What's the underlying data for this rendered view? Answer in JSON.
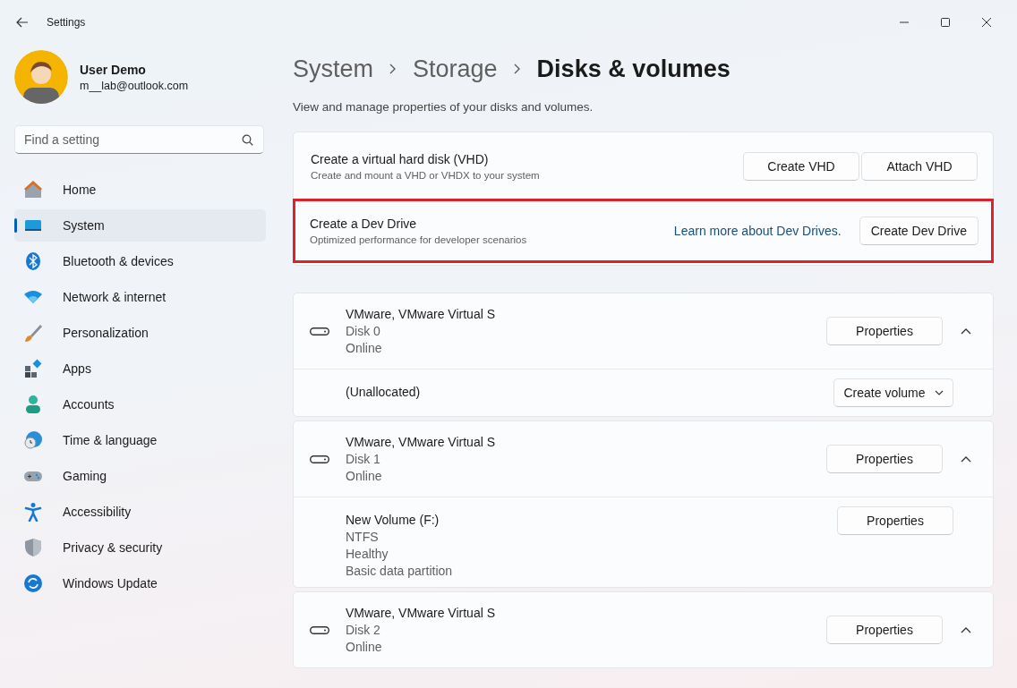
{
  "window": {
    "title": "Settings"
  },
  "user": {
    "name": "User Demo",
    "email": "m__lab@outlook.com"
  },
  "search": {
    "placeholder": "Find a setting"
  },
  "sidebar": {
    "items": [
      {
        "label": "Home",
        "selected": false
      },
      {
        "label": "System",
        "selected": true
      },
      {
        "label": "Bluetooth & devices",
        "selected": false
      },
      {
        "label": "Network & internet",
        "selected": false
      },
      {
        "label": "Personalization",
        "selected": false
      },
      {
        "label": "Apps",
        "selected": false
      },
      {
        "label": "Accounts",
        "selected": false
      },
      {
        "label": "Time & language",
        "selected": false
      },
      {
        "label": "Gaming",
        "selected": false
      },
      {
        "label": "Accessibility",
        "selected": false
      },
      {
        "label": "Privacy & security",
        "selected": false
      },
      {
        "label": "Windows Update",
        "selected": false
      }
    ]
  },
  "breadcrumb": [
    "System",
    "Storage",
    "Disks & volumes"
  ],
  "description": "View and manage properties of your disks and volumes.",
  "actions": [
    {
      "title": "Create a virtual hard disk (VHD)",
      "subtitle": "Create and mount a VHD or VHDX to your system",
      "highlighted": false,
      "buttons": [
        "Create VHD",
        "Attach VHD"
      ]
    },
    {
      "title": "Create a Dev Drive",
      "subtitle": "Optimized performance for developer scenarios",
      "highlighted": true,
      "link": "Learn more about Dev Drives.",
      "buttons": [
        "Create Dev Drive"
      ]
    }
  ],
  "disks": [
    {
      "name": "VMware, VMware Virtual S",
      "disk": "Disk 0",
      "status": "Online",
      "button": "Properties",
      "expanded": true,
      "volumes": [
        {
          "kind": "unallocated",
          "name": "(Unallocated)",
          "button": "Create volume"
        }
      ]
    },
    {
      "name": "VMware, VMware Virtual S",
      "disk": "Disk 1",
      "status": "Online",
      "button": "Properties",
      "expanded": true,
      "volumes": [
        {
          "kind": "volume",
          "name": "New Volume (F:)",
          "details": [
            "NTFS",
            "Healthy",
            "Basic data partition"
          ],
          "button": "Properties"
        }
      ]
    },
    {
      "name": "VMware, VMware Virtual S",
      "disk": "Disk 2",
      "status": "Online",
      "button": "Properties",
      "expanded": true
    }
  ]
}
